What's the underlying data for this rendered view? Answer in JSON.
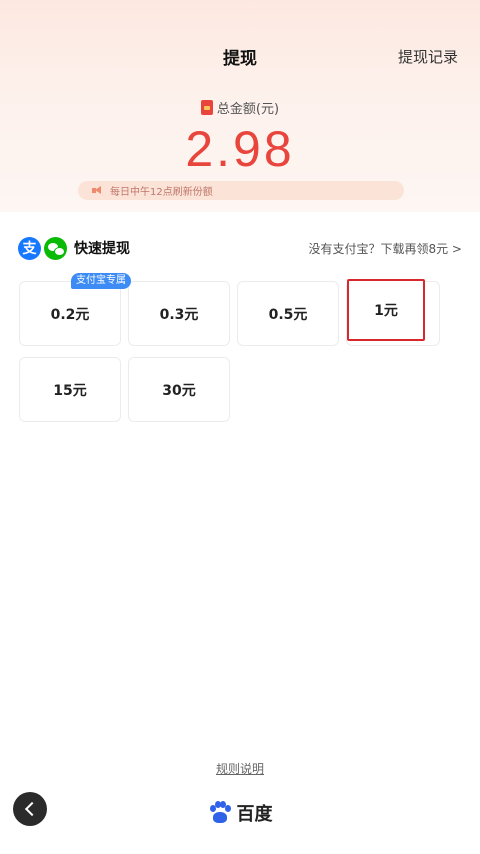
{
  "header": {
    "title": "提现",
    "records_link": "提现记录"
  },
  "balance": {
    "label": "总金额(元)",
    "amount": "2.98",
    "notice": "每日中午12点刷新份额"
  },
  "quick": {
    "title": "快速提现",
    "link": "没有支付宝？下载再领8元 >",
    "alipay_glyph": "支"
  },
  "options": {
    "tag": "支付宝专属",
    "items": [
      {
        "label": "0.2元"
      },
      {
        "label": "0.3元"
      },
      {
        "label": "0.5元"
      },
      {
        "label": "1元",
        "selected": true
      },
      {
        "label": "15元"
      },
      {
        "label": "30元"
      }
    ]
  },
  "footer": {
    "rules": "规则说明",
    "brand": "百度"
  },
  "colors": {
    "accent_red": "#e8453c",
    "alipay_blue": "#1677ff",
    "wechat_green": "#09bb07"
  }
}
